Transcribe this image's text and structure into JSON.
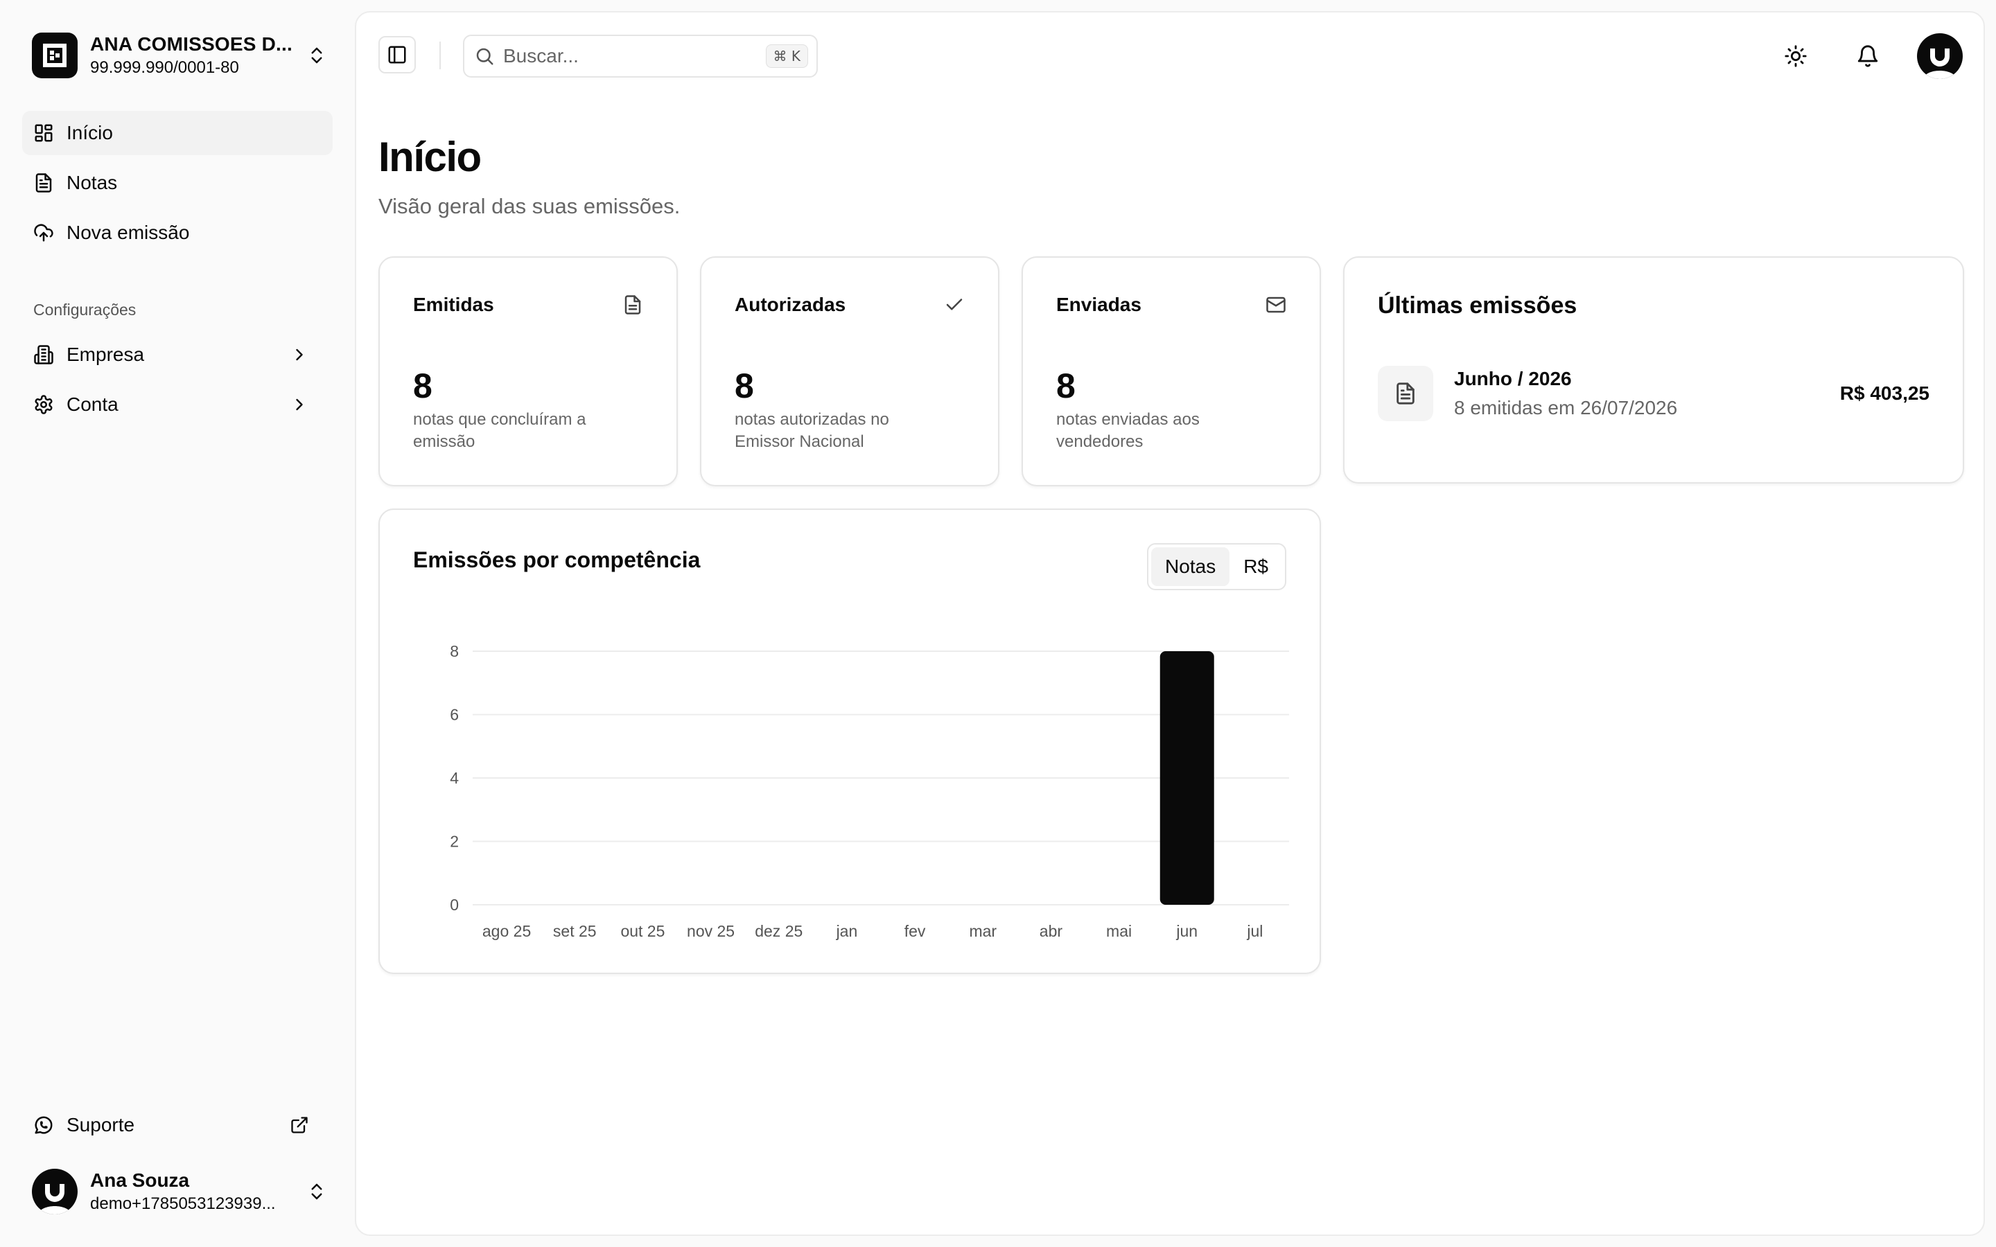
{
  "org": {
    "name": "ANA COMISSOES D...",
    "cnpj": "99.999.990/0001-80"
  },
  "nav": {
    "items": [
      {
        "label": "Início",
        "icon": "dashboard-icon"
      },
      {
        "label": "Notas",
        "icon": "file-text-icon"
      },
      {
        "label": "Nova emissão",
        "icon": "cloud-upload-icon"
      }
    ],
    "config_title": "Configurações",
    "config_items": [
      {
        "label": "Empresa",
        "icon": "building-icon"
      },
      {
        "label": "Conta",
        "icon": "gear-icon"
      }
    ],
    "support": {
      "label": "Suporte",
      "icon": "whatsapp-icon"
    }
  },
  "user": {
    "name": "Ana Souza",
    "email": "demo+1785053123939..."
  },
  "search": {
    "placeholder": "Buscar...",
    "shortcut": "⌘ K"
  },
  "page": {
    "title": "Início",
    "subtitle": "Visão geral das suas emissões."
  },
  "stats": [
    {
      "title": "Emitidas",
      "value": "8",
      "desc": "notas que concluíram a emissão",
      "icon": "file-icon"
    },
    {
      "title": "Autorizadas",
      "value": "8",
      "desc": "notas autorizadas no Emissor Nacional",
      "icon": "check-icon"
    },
    {
      "title": "Enviadas",
      "value": "8",
      "desc": "notas enviadas aos vendedores",
      "icon": "mail-icon"
    }
  ],
  "recent": {
    "title": "Últimas emissões",
    "items": [
      {
        "name": "Junho / 2026",
        "sub": "8 emitidas em 26/07/2026",
        "amount": "R$ 403,25"
      }
    ]
  },
  "chart_section": {
    "title": "Emissões por competência",
    "toggle": [
      {
        "label": "Notas",
        "active": true
      },
      {
        "label": "R$",
        "active": false
      }
    ]
  },
  "chart_data": {
    "type": "bar",
    "title": "Emissões por competência",
    "categories": [
      "ago 25",
      "set 25",
      "out 25",
      "nov 25",
      "dez 25",
      "jan",
      "fev",
      "mar",
      "abr",
      "mai",
      "jun",
      "jul"
    ],
    "values": [
      0,
      0,
      0,
      0,
      0,
      0,
      0,
      0,
      0,
      0,
      8,
      0
    ],
    "ylim": [
      0,
      8
    ],
    "yticks": [
      0,
      2,
      4,
      6,
      8
    ],
    "grid": true,
    "bar_color": "#0a0a0a"
  }
}
